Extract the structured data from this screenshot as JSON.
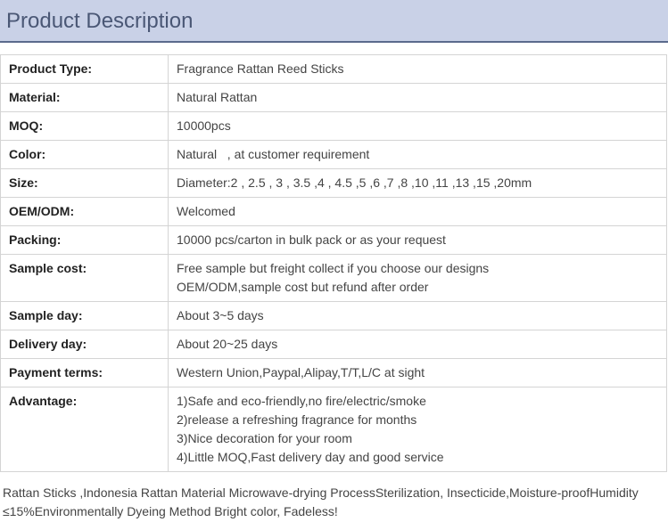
{
  "header": {
    "title": "Product Description"
  },
  "spec_rows": [
    {
      "label": "Product Type:",
      "lines": [
        "Fragrance Rattan Reed Sticks"
      ]
    },
    {
      "label": "Material:",
      "lines": [
        "Natural Rattan"
      ]
    },
    {
      "label": "MOQ:",
      "lines": [
        "10000pcs"
      ]
    },
    {
      "label": "Color:",
      "lines": [
        "Natural   , at customer requirement"
      ]
    },
    {
      "label": "Size:",
      "lines": [
        "Diameter:2 , 2.5 , 3 , 3.5 ,4 , 4.5 ,5 ,6 ,7 ,8 ,10 ,11 ,13 ,15 ,20mm"
      ]
    },
    {
      "label": "OEM/ODM:",
      "lines": [
        "Welcomed"
      ]
    },
    {
      "label": "Packing:",
      "lines": [
        "10000 pcs/carton in bulk pack or as your request"
      ]
    },
    {
      "label": "Sample cost:",
      "lines": [
        "Free sample but freight collect if you choose our designs",
        "OEM/ODM,sample cost but refund after order"
      ]
    },
    {
      "label": "Sample day:",
      "lines": [
        "About 3~5 days"
      ]
    },
    {
      "label": "Delivery day:",
      "lines": [
        "About 20~25 days"
      ]
    },
    {
      "label": "Payment terms:",
      "lines": [
        "Western Union,Paypal,Alipay,T/T,L/C at sight"
      ]
    },
    {
      "label": "Advantage:",
      "lines": [
        "1)Safe and eco-friendly,no fire/electric/smoke",
        "2)release a refreshing fragrance for months",
        "3)Nice decoration for your room",
        "4)Little MOQ,Fast delivery day and good service"
      ]
    }
  ],
  "footer": {
    "text": "Rattan Sticks ,Indonesia Rattan Material Microwave-drying ProcessSterilization, Insecticide,Moisture-proofHumidity ≤15%Environmentally Dyeing Method Bright color, Fadeless!"
  }
}
